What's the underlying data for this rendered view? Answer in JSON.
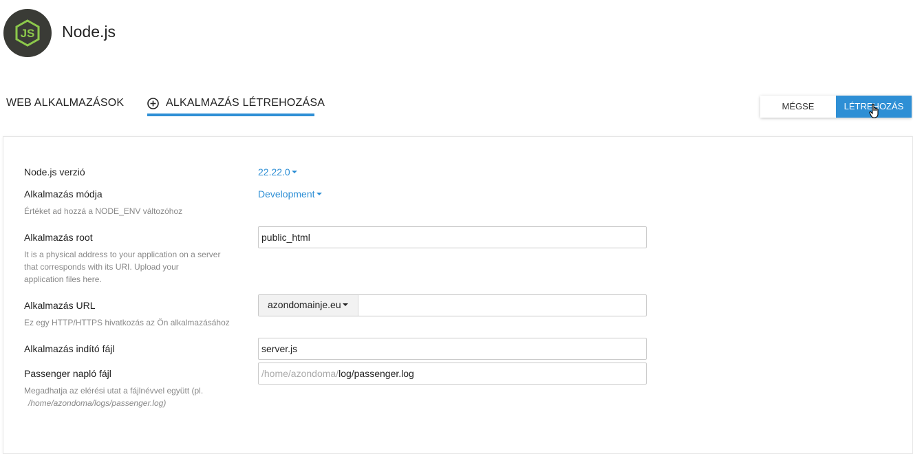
{
  "header": {
    "app_title": "Node.js",
    "logo_icon": "nodejs-logo"
  },
  "tabs": {
    "web_apps": "WEB ALKALMAZÁSOK",
    "create_app": "ALKALMAZÁS LÉTREHOZÁSA",
    "active": "create_app"
  },
  "actions": {
    "cancel": "MÉGSE",
    "create": "LÉTREHOZÁS"
  },
  "form": {
    "node_version": {
      "label": "Node.js verzió",
      "value": "22.22.0"
    },
    "app_mode": {
      "label": "Alkalmazás módja",
      "value": "Development",
      "hint": "Értéket ad hozzá a NODE_ENV változóhoz"
    },
    "app_root": {
      "label": "Alkalmazás root",
      "value": "public_html",
      "hint_lines": [
        "It is a physical address to your application on a server",
        "that corresponds with its URI. Upload your",
        "application files here."
      ]
    },
    "app_url": {
      "label": "Alkalmazás URL",
      "domain": "azondomainje.eu",
      "path": "",
      "hint": "Ez egy HTTP/HTTPS hivatkozás az Ön alkalmazásához"
    },
    "startup_file": {
      "label": "Alkalmazás indító fájl",
      "value": "server.js"
    },
    "passenger_log": {
      "label": "Passenger napló fájl",
      "prefix": "/home/azondoma/",
      "value": "log/passenger.log",
      "hint_lines": [
        "Megadhatja az elérési utat a fájlnévvel együtt (pl.",
        "/home/azondoma/logs/passenger.log)"
      ]
    }
  },
  "colors": {
    "accent": "#2e8fd5",
    "logo_bg": "#3a3b36",
    "logo_green": "#8cc84b"
  }
}
